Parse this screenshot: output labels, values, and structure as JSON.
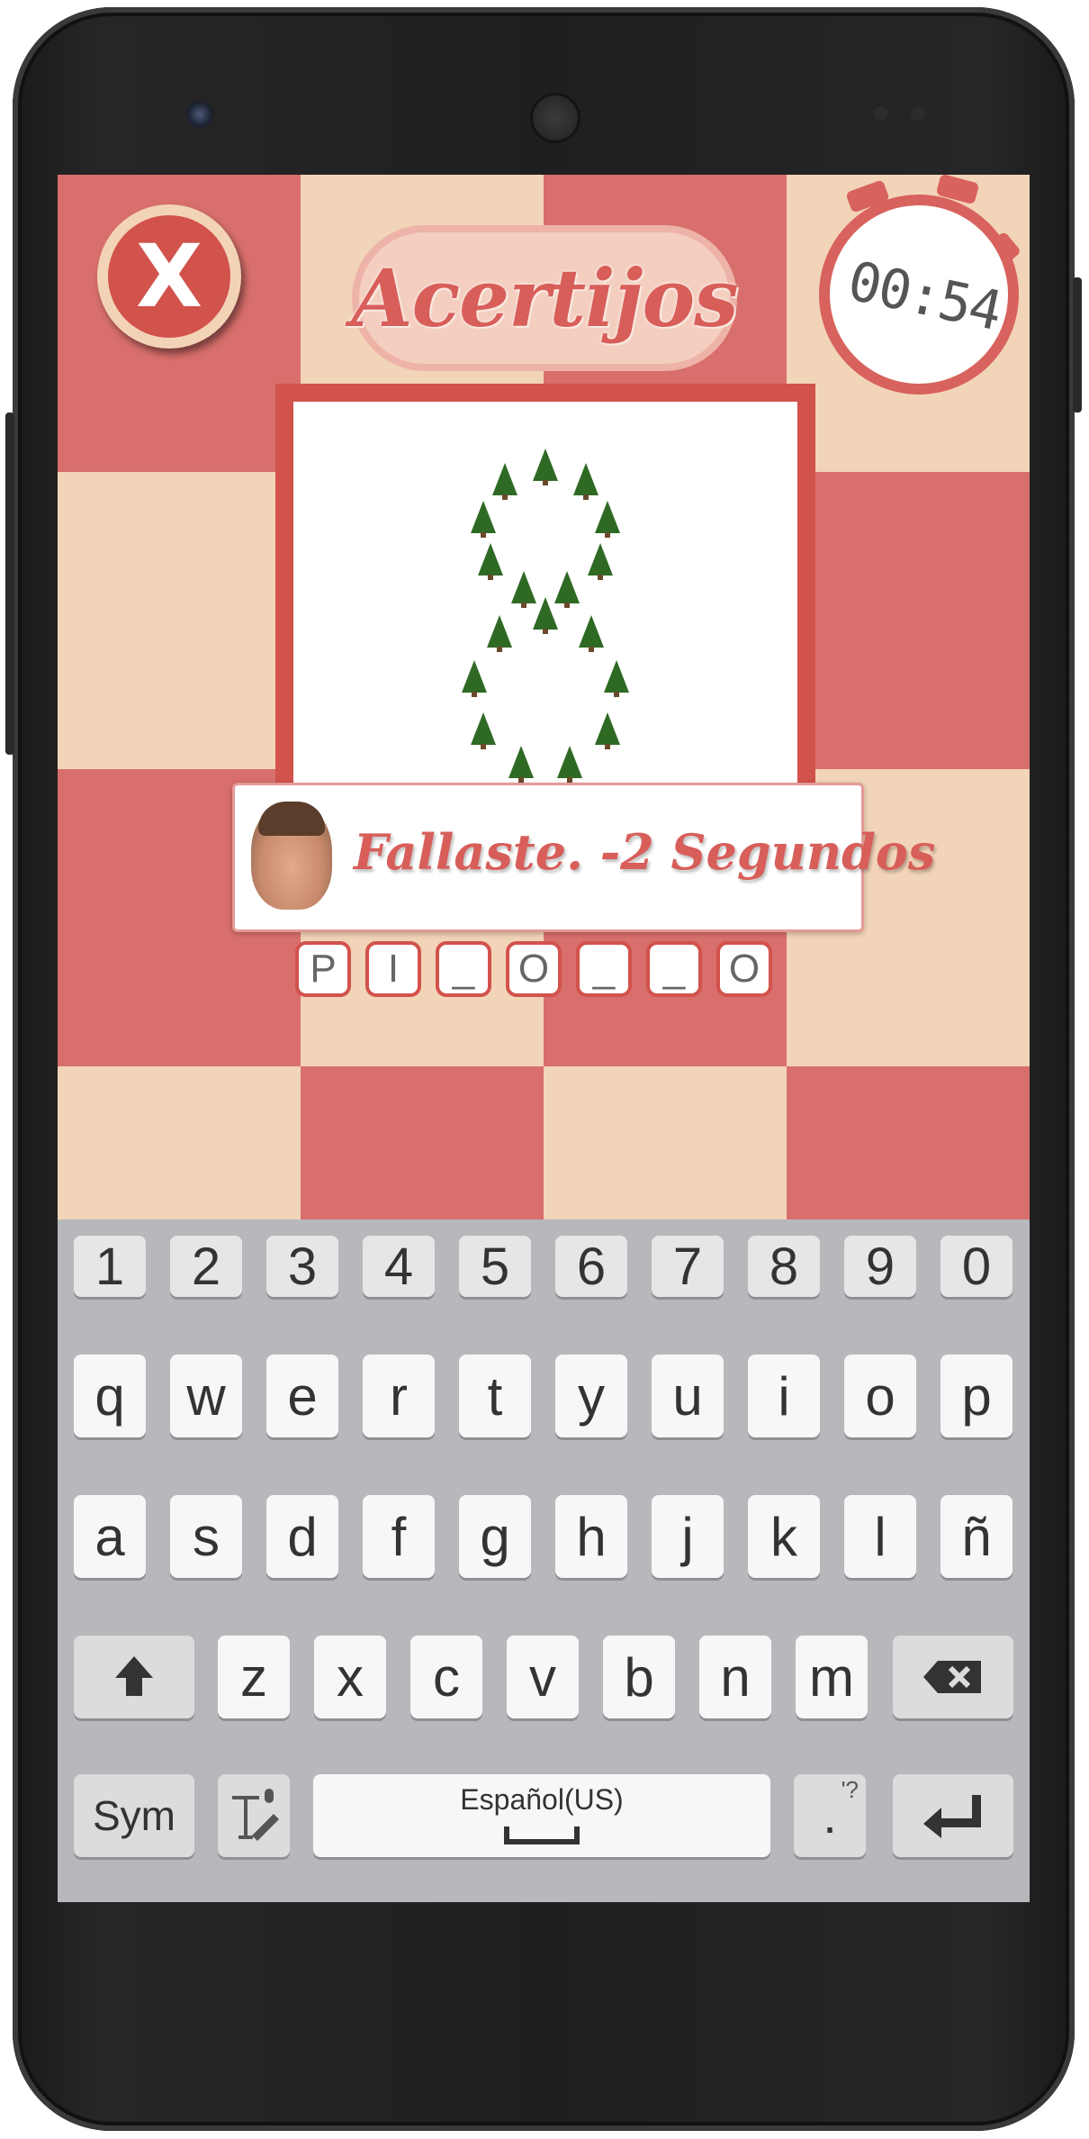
{
  "app": {
    "logo_text": "Acertijos",
    "close_label": "X",
    "timer": "00:54"
  },
  "toast": {
    "message": "Fallaste. -2 Segundos"
  },
  "answer_slots": [
    "P",
    "I",
    "_",
    "O",
    "_",
    "_",
    "O"
  ],
  "keyboard": {
    "numbers": [
      "1",
      "2",
      "3",
      "4",
      "5",
      "6",
      "7",
      "8",
      "9",
      "0"
    ],
    "row1": [
      "q",
      "w",
      "e",
      "r",
      "t",
      "y",
      "u",
      "i",
      "o",
      "p"
    ],
    "row2": [
      "a",
      "s",
      "d",
      "f",
      "g",
      "h",
      "j",
      "k",
      "l",
      "ñ"
    ],
    "row3": [
      "z",
      "x",
      "c",
      "v",
      "b",
      "n",
      "m"
    ],
    "sym_label": "Sym",
    "space_label": "Español(US)",
    "punct_label": "'?",
    "punct_dot": "."
  },
  "colors": {
    "tile_red": "#d86f6c",
    "tile_cream": "#f2d4b8",
    "accent": "#d2524c",
    "keyboard_bg": "#b7b8bc"
  }
}
